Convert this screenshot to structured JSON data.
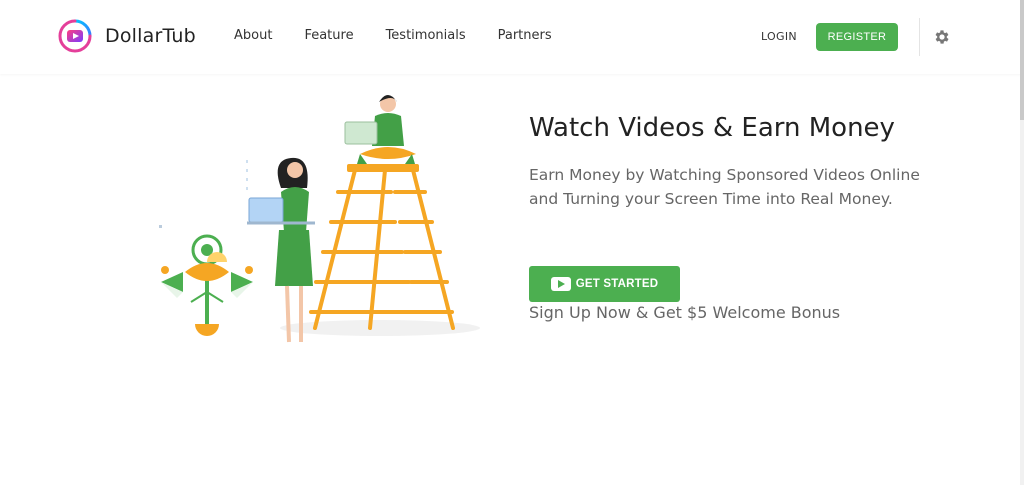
{
  "brand": {
    "name": "DollarTub",
    "logo_icon": "play-logo-icon"
  },
  "nav": {
    "links": [
      "About",
      "Feature",
      "Testimonials",
      "Partners"
    ],
    "login_label": "LOGIN",
    "register_label": "REGISTER",
    "settings_icon": "gear-icon"
  },
  "hero": {
    "title": "Watch Videos & Earn Money",
    "subtitle": "Earn Money by Watching Sponsored Videos Online and Turning your Screen Time into Real Money.",
    "cta_label": "GET STARTED",
    "cta_icon": "youtube-play-icon",
    "bonus_text": "Sign Up Now & Get $5 Welcome Bonus"
  },
  "colors": {
    "accent": "#4caf50",
    "ladder": "#f5a623",
    "text_dark": "#222222",
    "text_muted": "#666666"
  }
}
